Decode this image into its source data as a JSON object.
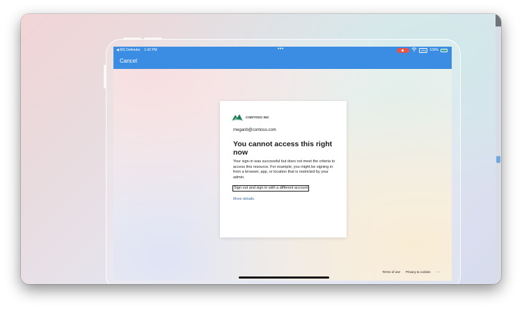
{
  "status_bar": {
    "back_app": "◀ MS Defender",
    "time": "1:42 PM",
    "dots": "•••",
    "battery_percent": "100%",
    "vpn": "VPN"
  },
  "nav": {
    "cancel_label": "Cancel"
  },
  "signin_card": {
    "brand": "CONTOSO INC",
    "email": "meganb@contoso.com",
    "title": "You cannot access this right now",
    "body": "Your sign-in was successful but does not meet the criteria to access this resource. For example, you might be signing in from a browser, app, or location that is restricted by your admin.",
    "signout_link": "Sign out and sign in with a different account",
    "details_link": "More details"
  },
  "footer": {
    "terms": "Terms of use",
    "privacy": "Privacy & cookies",
    "more": "..."
  },
  "colors": {
    "topbar": "#3a8de3",
    "link": "#3f6ea3",
    "recording": "#e2564c",
    "battery": "#34c759"
  },
  "icons": [
    "back-arrow-icon",
    "recording-icon",
    "wifi-icon",
    "battery-icon",
    "contoso-logo-icon",
    "more-options-icon"
  ]
}
